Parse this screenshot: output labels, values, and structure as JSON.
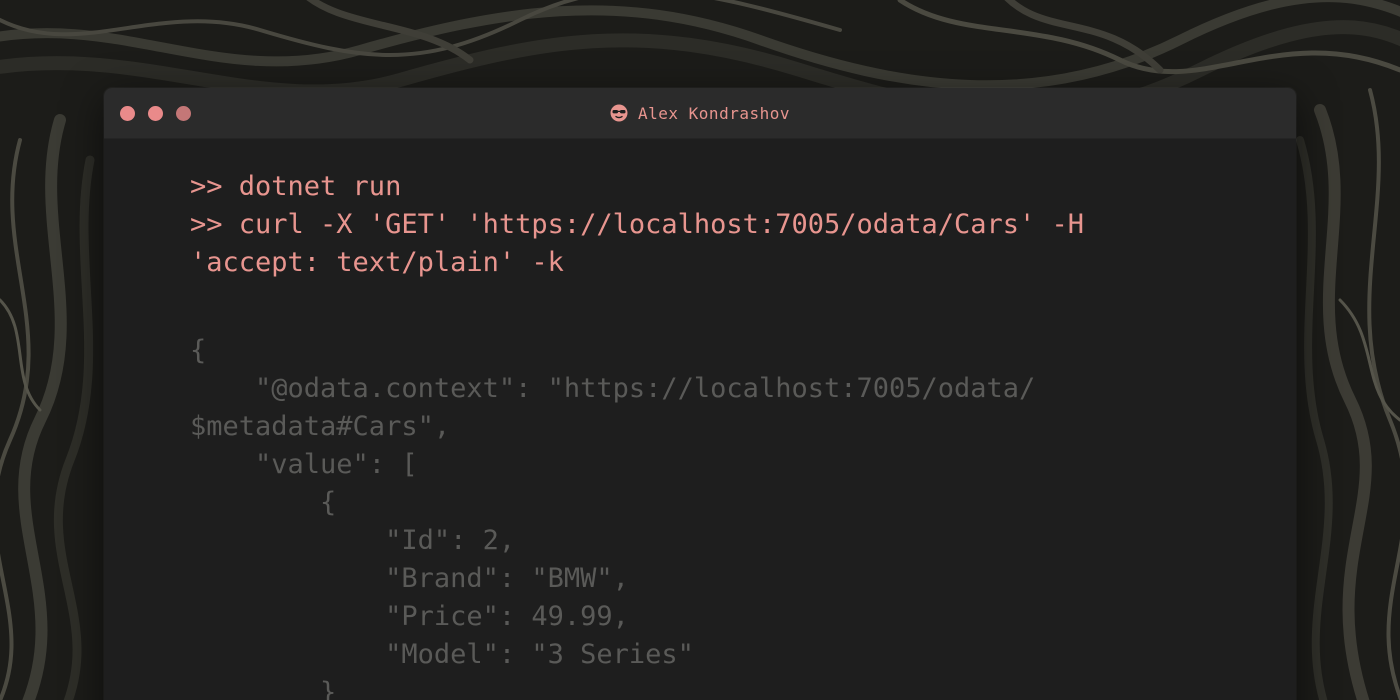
{
  "window": {
    "title": "Alex Kondrashov",
    "avatar_icon": "sunglasses-face-icon",
    "controls": [
      "close-dot",
      "minimize-dot",
      "maximize-dot"
    ]
  },
  "colors": {
    "accent": "#e8958f",
    "output": "#5a5a58",
    "titlebar": "#2b2b2b",
    "terminal_bg": "#1e1e1e",
    "dot": "#e98a8a"
  },
  "terminal": {
    "commands": [
      ">> dotnet run",
      ">> curl -X 'GET' 'https://localhost:7005/odata/Cars' -H",
      "'accept: text/plain' -k"
    ],
    "output": [
      "{",
      "    \"@odata.context\": \"https://localhost:7005/odata/",
      "$metadata#Cars\",",
      "    \"value\": [",
      "        {",
      "            \"Id\": 2,",
      "            \"Brand\": \"BMW\",",
      "            \"Price\": 49.99,",
      "            \"Model\": \"3 Series\"",
      "        }"
    ]
  }
}
